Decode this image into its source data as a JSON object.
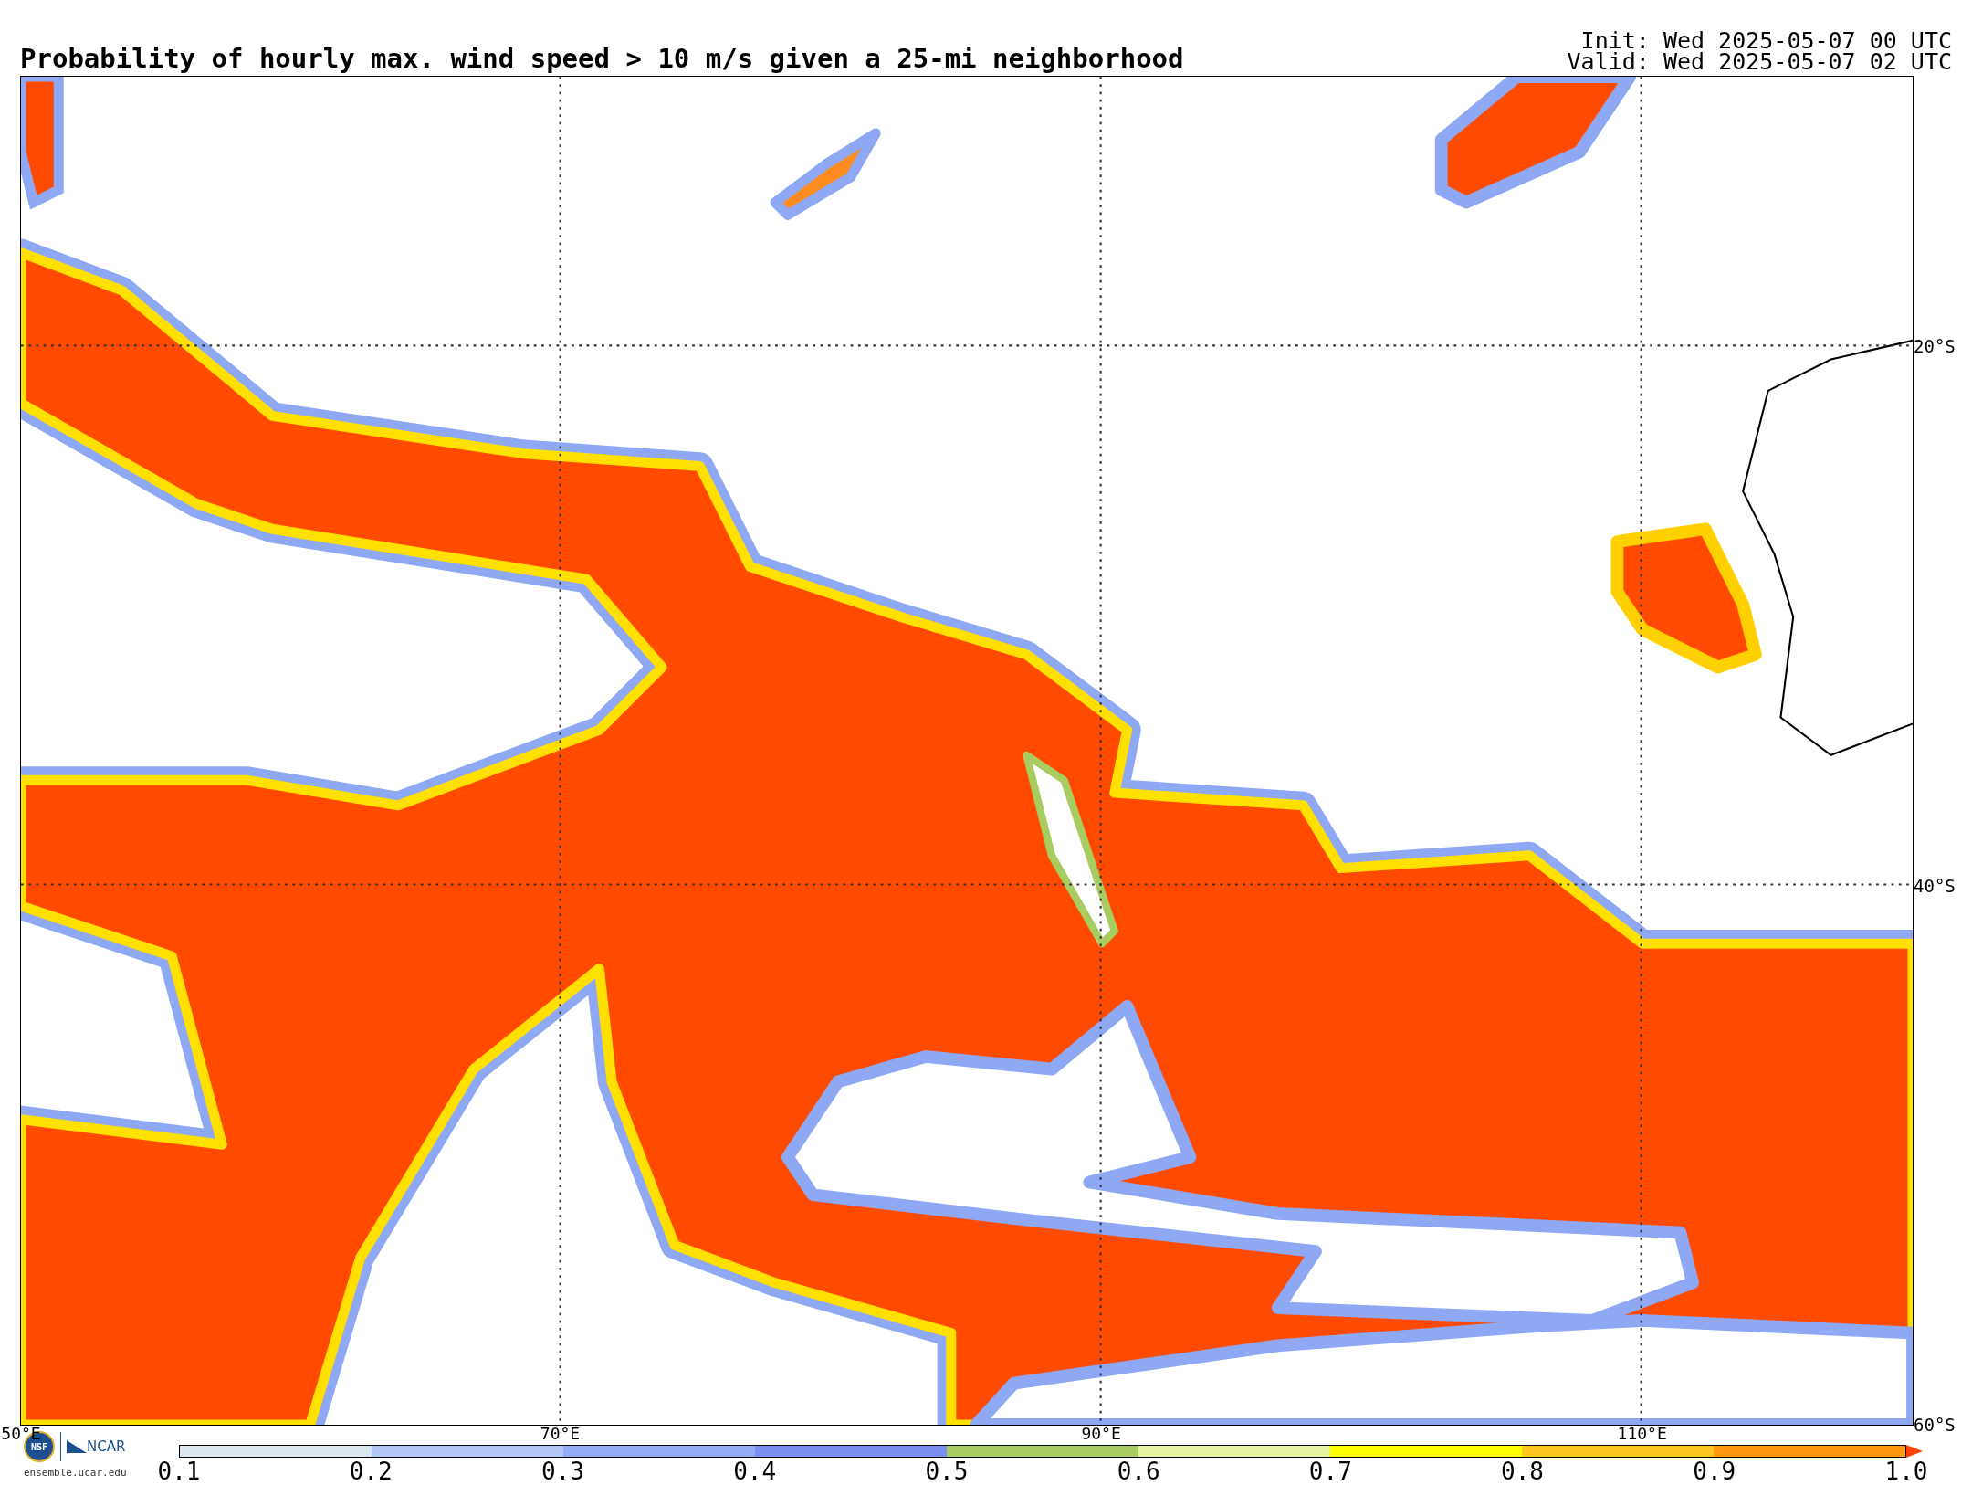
{
  "title": "Probability of hourly max. wind speed > 10 m/s given a 25-mi neighborhood",
  "init": "Init: Wed 2025-05-07 00 UTC",
  "valid": "Valid: Wed 2025-05-07 02 UTC",
  "map": {
    "longitude_labels": [
      "50°E",
      "70°E",
      "90°E",
      "110°E"
    ],
    "latitude_labels": [
      "20°S",
      "40°S",
      "60°S"
    ]
  },
  "logos": {
    "nsf": "NSF",
    "ncar": "NCAR",
    "url": "ensemble.ucar.edu"
  },
  "colorbar": {
    "segments": [
      {
        "color": "#dce6ee"
      },
      {
        "color": "#b4c8f8"
      },
      {
        "color": "#92acf6"
      },
      {
        "color": "#7a8ef0"
      },
      {
        "color": "#a8cc60"
      },
      {
        "color": "#e6f2a0"
      },
      {
        "color": "#ffff00"
      },
      {
        "color": "#ffc820"
      },
      {
        "color": "#ff9a10"
      },
      {
        "kind": "extension",
        "color": "#ff4500"
      }
    ],
    "ticks": [
      "0.1",
      "0.2",
      "0.3",
      "0.4",
      "0.5",
      "0.6",
      "0.7",
      "0.8",
      "0.9",
      "1.0"
    ]
  }
}
